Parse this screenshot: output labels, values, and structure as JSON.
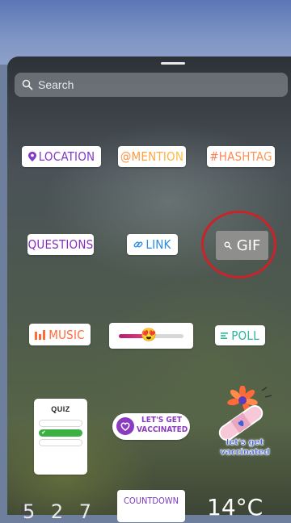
{
  "search": {
    "placeholder": "Search"
  },
  "stickers": {
    "location": "LOCATION",
    "mention": "@MENTION",
    "hashtag": "#HASHTAG",
    "questions": "QUESTIONS",
    "link": "LINK",
    "gif": "GIF",
    "music": "MUSIC",
    "poll": "POLL",
    "quiz": "QUIZ",
    "vaccinated_line1": "LET'S GET",
    "vaccinated_line2": "VACCINATED",
    "vaccinated2_line1": "let's get",
    "vaccinated2_line2": "vaccinated",
    "countdown": "COUNTDOWN",
    "time": "5 2 7",
    "temperature": "14°C"
  },
  "emoji_slider": {
    "emoji": "😍",
    "level": 0.45
  },
  "colors": {
    "highlight_ring": "#c8242a",
    "location": "#8239c8",
    "link": "#2a8ae5",
    "poll": "#2bb59a",
    "music": "#ff6a3a"
  }
}
